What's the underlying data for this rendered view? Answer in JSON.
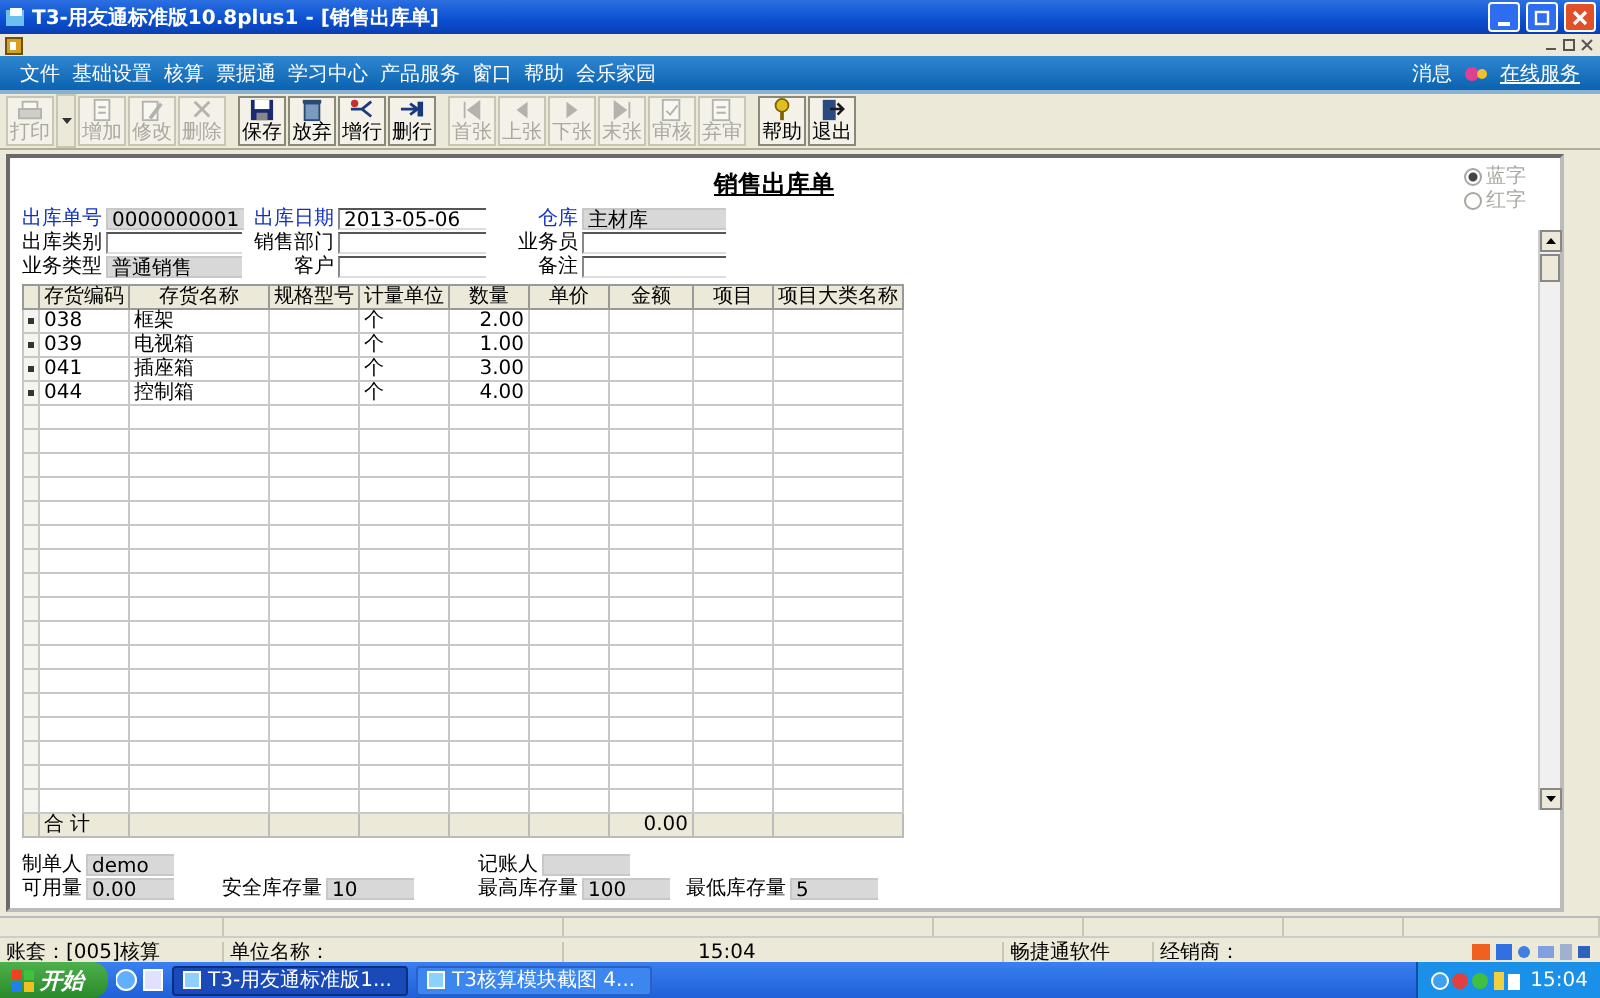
{
  "window": {
    "title": "T3-用友通标准版10.8plus1 - [销售出库单]"
  },
  "menubar": {
    "menus": [
      "文件",
      "基础设置",
      "核算",
      "票据通",
      "学习中心",
      "产品服务",
      "窗口",
      "帮助",
      "会乐家园"
    ],
    "links": [
      "消息",
      "在线服务"
    ]
  },
  "toolbar": [
    {
      "label": "打印",
      "disabled": true
    },
    {
      "label": "增加",
      "disabled": true
    },
    {
      "label": "修改",
      "disabled": true
    },
    {
      "label": "删除",
      "disabled": true
    },
    {
      "label": "保存",
      "disabled": false
    },
    {
      "label": "放弃",
      "disabled": false
    },
    {
      "label": "增行",
      "disabled": false
    },
    {
      "label": "删行",
      "disabled": false
    },
    {
      "label": "首张",
      "disabled": true
    },
    {
      "label": "上张",
      "disabled": true
    },
    {
      "label": "下张",
      "disabled": true
    },
    {
      "label": "末张",
      "disabled": true
    },
    {
      "label": "审核",
      "disabled": true
    },
    {
      "label": "弃审",
      "disabled": true
    },
    {
      "label": "帮助",
      "disabled": false
    },
    {
      "label": "退出",
      "disabled": false
    }
  ],
  "form": {
    "title": "销售出库单",
    "color_options": [
      {
        "label": "蓝字",
        "selected": true,
        "disabled": true
      },
      {
        "label": "红字",
        "selected": false,
        "disabled": true
      }
    ],
    "header_fields": [
      {
        "label": "出库单号",
        "value": "0000000001",
        "required": true,
        "readonly": true
      },
      {
        "label": "出库日期",
        "value": "2013-05-06",
        "required": true,
        "readonly": false
      },
      {
        "label": "仓库",
        "value": "主材库",
        "required": true,
        "readonly": true
      },
      {
        "label": "出库类别",
        "required": false,
        "readonly": false
      },
      {
        "label": "销售部门",
        "required": false,
        "readonly": false
      },
      {
        "label": "业务员",
        "required": false,
        "readonly": false
      },
      {
        "label": "业务类型",
        "value": "普通销售",
        "required": false,
        "readonly": true
      },
      {
        "label": "客户",
        "required": false,
        "readonly": false
      },
      {
        "label": "备注",
        "required": false,
        "readonly": false
      }
    ],
    "table": {
      "columns": [
        "存货编码",
        "存货名称",
        "规格型号",
        "计量单位",
        "数量",
        "单价",
        "金额",
        "项目",
        "项目大类名称"
      ],
      "rows": [
        {
          "code": "038",
          "name": "框架",
          "unit": "个",
          "quantity": "2.00"
        },
        {
          "code": "039",
          "name": "电视箱",
          "unit": "个",
          "quantity": "1.00"
        },
        {
          "code": "041",
          "name": "插座箱",
          "unit": "个",
          "quantity": "3.00"
        },
        {
          "code": "044",
          "name": "控制箱",
          "unit": "个",
          "quantity": "4.00"
        }
      ],
      "total": {
        "label": "合 计",
        "amount": "0.00"
      }
    },
    "footer_rows": [
      [
        {
          "label": "制单人",
          "value": "demo"
        },
        {
          "label": "记账人"
        }
      ],
      [
        {
          "label": "可用量",
          "value": "0.00"
        },
        {
          "label": "安全库存量",
          "value": "10"
        },
        {
          "label": "最高库存量",
          "value": "100"
        },
        {
          "label": "最低库存量",
          "value": "5"
        }
      ]
    ]
  },
  "status_bar": [
    "账套：[005]核算",
    "单位名称：",
    "15:04",
    "畅捷通软件",
    "经销商："
  ],
  "taskbar": {
    "start": "开始",
    "tasks": [
      {
        "label": "T3-用友通标准版1...",
        "selected": true
      },
      {
        "label": "T3核算模块截图 4...",
        "selected": false
      }
    ],
    "clock": "15:04"
  }
}
